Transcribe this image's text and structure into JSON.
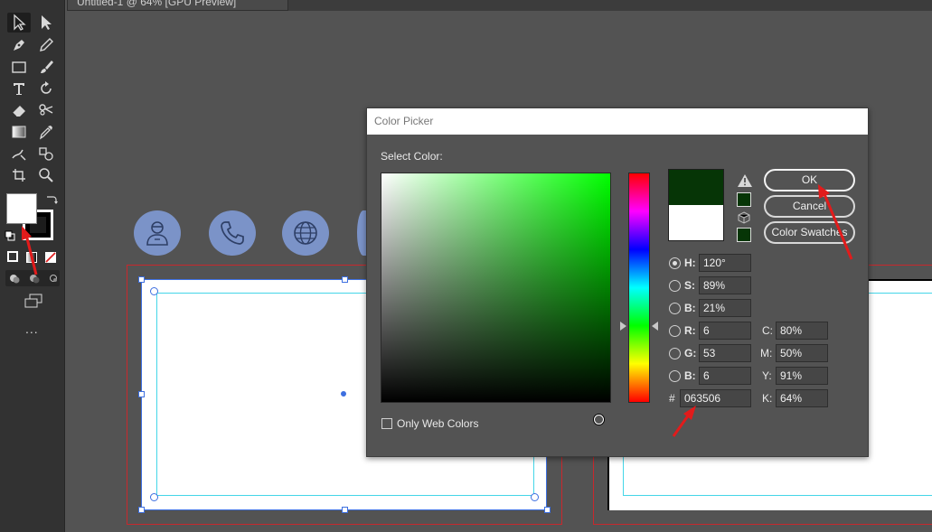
{
  "document_tab": {
    "title": "Untitled-1 @ 64% [GPU Preview]"
  },
  "toolbar": {
    "tools": [
      {
        "name": "selection-tool-icon"
      },
      {
        "name": "direct-selection-tool-icon"
      },
      {
        "name": "pen-tool-icon"
      },
      {
        "name": "pencil-tool-icon"
      },
      {
        "name": "rectangle-frame-tool-icon"
      },
      {
        "name": "brush-tool-icon"
      },
      {
        "name": "type-tool-icon"
      },
      {
        "name": "rotate-tool-icon"
      },
      {
        "name": "eraser-tool-icon"
      },
      {
        "name": "scissors-tool-icon"
      },
      {
        "name": "gradient-tool-icon"
      },
      {
        "name": "eyedropper-tool-icon"
      },
      {
        "name": "free-transform-tool-icon"
      },
      {
        "name": "shape-builder-tool-icon"
      },
      {
        "name": "artboard-tool-icon"
      },
      {
        "name": "zoom-tool-icon"
      }
    ],
    "fill_color": "#ffffff",
    "stroke_color": "#000000",
    "more_label": "..."
  },
  "dialog": {
    "title": "Color Picker",
    "select_color_label": "Select Color:",
    "new_color": "#063506",
    "old_color": "#ffffff",
    "buttons": {
      "ok": "OK",
      "cancel": "Cancel",
      "color_swatches": "Color Swatches"
    },
    "hsb": [
      {
        "label": "H:",
        "value": "120°",
        "selected": true
      },
      {
        "label": "S:",
        "value": "89%",
        "selected": false
      },
      {
        "label": "B:",
        "value": "21%",
        "selected": false
      }
    ],
    "rgb": [
      {
        "label": "R:",
        "value": "6"
      },
      {
        "label": "G:",
        "value": "53"
      },
      {
        "label": "B:",
        "value": "6"
      }
    ],
    "cmyk": [
      {
        "label": "C:",
        "value": "80%"
      },
      {
        "label": "M:",
        "value": "50%"
      },
      {
        "label": "Y:",
        "value": "91%"
      },
      {
        "label": "K:",
        "value": "64%"
      }
    ],
    "hex_label": "#",
    "hex_value": "063506",
    "only_web_colors_label": "Only Web Colors",
    "only_web_colors_checked": false
  },
  "canvas": {
    "icons": [
      "user-icon",
      "phone-icon",
      "globe-icon"
    ],
    "icon_color": "#7b93c8"
  }
}
